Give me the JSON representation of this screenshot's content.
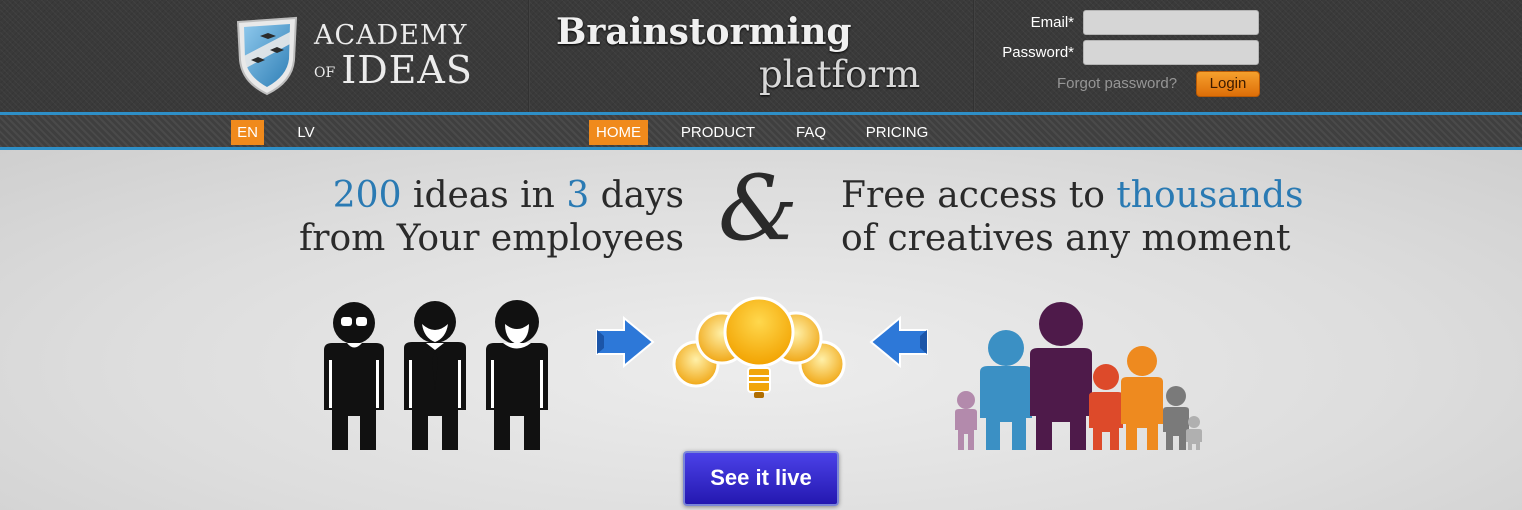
{
  "brand": {
    "line1": "ACADEMY",
    "of": "OF",
    "line2": "IDEAS"
  },
  "header": {
    "title": "Brainstorming",
    "subtitle": "platform"
  },
  "login": {
    "email_label": "Email*",
    "email_value": "",
    "password_label": "Password*",
    "password_value": "",
    "forgot_label": "Forgot password?",
    "button_label": "Login"
  },
  "nav": {
    "languages": [
      {
        "label": "EN",
        "active": true
      },
      {
        "label": "LV",
        "active": false
      }
    ],
    "items": [
      {
        "label": "HOME",
        "active": true
      },
      {
        "label": "PRODUCT",
        "active": false
      },
      {
        "label": "FAQ",
        "active": false
      },
      {
        "label": "PRICING",
        "active": false
      }
    ]
  },
  "hero": {
    "left": {
      "num1": "200",
      "text1": " ideas in ",
      "num2": "3",
      "text2": " days",
      "line2": "from Your employees"
    },
    "ampersand": "&",
    "right": {
      "text1": "Free access to ",
      "highlight": "thousands",
      "line2": "of creatives any moment"
    }
  },
  "cta": {
    "label": "See it live"
  },
  "colors": {
    "accent_orange": "#f08a1c",
    "nav_blue": "#2e8fc7",
    "headline_blue": "#2a7ab3",
    "cta_blue": "#3a2fd0",
    "arrow_blue": "#2d78d8",
    "family": [
      "#b38aac",
      "#3b90c4",
      "#4e1a4a",
      "#dd4a2a",
      "#ee8a1f",
      "#7a7a7a",
      "#b0b0b0"
    ]
  },
  "icons": {
    "logo": "shield-logo-icon",
    "employees": "employees-icon",
    "arrow_right": "arrow-right-icon",
    "arrow_left": "arrow-left-icon",
    "bulbs": "lightbulbs-icon",
    "family": "family-icon"
  }
}
